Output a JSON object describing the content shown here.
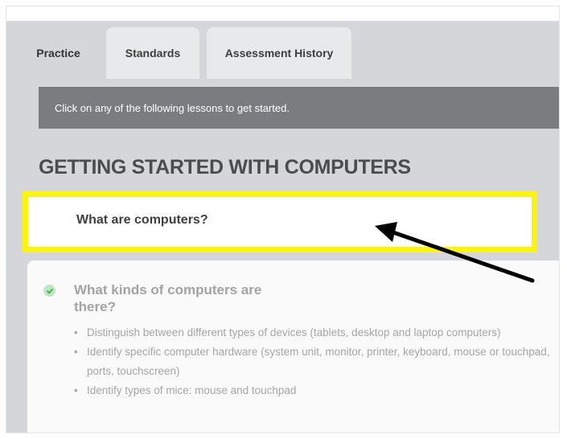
{
  "tabs": [
    {
      "label": "Practice",
      "active": true
    },
    {
      "label": "Standards",
      "active": false
    },
    {
      "label": "Assessment History",
      "active": false
    }
  ],
  "notice": "Click on any of the following lessons to get started.",
  "unit": {
    "title": "GETTING STARTED WITH COMPUTERS",
    "lessons": [
      {
        "title": "What are computers?",
        "highlighted": true
      },
      {
        "title": "What kinds of computers are there?",
        "completed": true,
        "objectives": [
          "Distinguish between different types of devices (tablets, desktop and laptop computers)",
          "Identify specific computer hardware (system unit, monitor, printer, keyboard, mouse or touchpad, ports, touchscreen)",
          "Identify types of mice: mouse and touchpad"
        ]
      }
    ]
  },
  "colors": {
    "highlight_border": "#fbf412",
    "notice_bg": "#7b7c7f",
    "panel_bg": "#d4d6d9",
    "check_green": "#3cab4a"
  }
}
